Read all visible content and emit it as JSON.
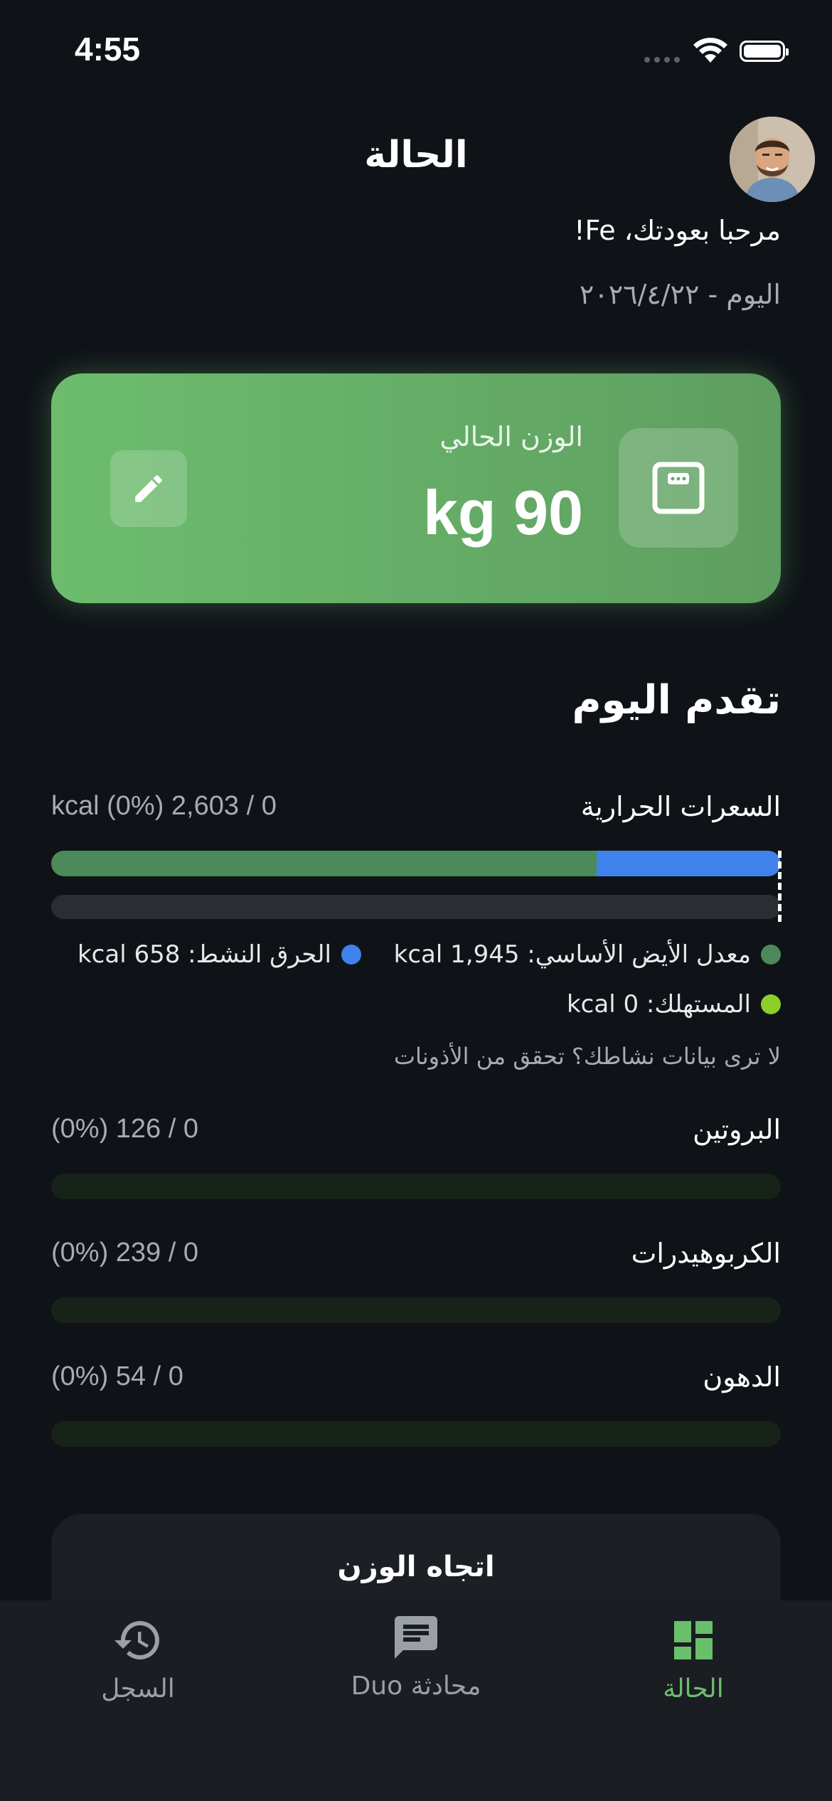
{
  "status_bar": {
    "time": "4:55"
  },
  "header": {
    "title": "الحالة",
    "greeting": "مرحبا بعودتك، Fe!",
    "date": "اليوم - ٢٠٢٦/٤/٢٢"
  },
  "weight_card": {
    "label": "الوزن الحالي",
    "value": "kg 90"
  },
  "progress": {
    "title": "تقدم اليوم",
    "calories": {
      "label": "السعرات الحرارية",
      "value": "kcal (0%) 2,603 / 0",
      "bmr_fraction": 0.748,
      "active_fraction": 0.252
    },
    "legend": {
      "bmr": "معدل الأيض الأساسي: kcal 1,945",
      "active": "الحرق النشط: kcal 658",
      "consumed": "المستهلك: kcal 0"
    },
    "hint": "لا ترى بيانات نشاطك؟ تحقق من الأذونات",
    "macros": [
      {
        "label": "البروتين",
        "value": "(0%) 126 / 0",
        "fraction": 0
      },
      {
        "label": "الكربوهيدرات",
        "value": "(0%) 239 / 0",
        "fraction": 0
      },
      {
        "label": "الدهون",
        "value": "(0%) 54 / 0",
        "fraction": 0
      }
    ]
  },
  "trend_card": {
    "title": "اتجاه الوزن"
  },
  "bottom_nav": {
    "history": "السجل",
    "chat": "محادثة Duo",
    "status": "الحالة"
  },
  "colors": {
    "accent_green": "#6abf6b",
    "bmr_green": "#4c8a5a",
    "active_blue": "#3f82ec",
    "consumed_lime": "#8ccf2a"
  }
}
